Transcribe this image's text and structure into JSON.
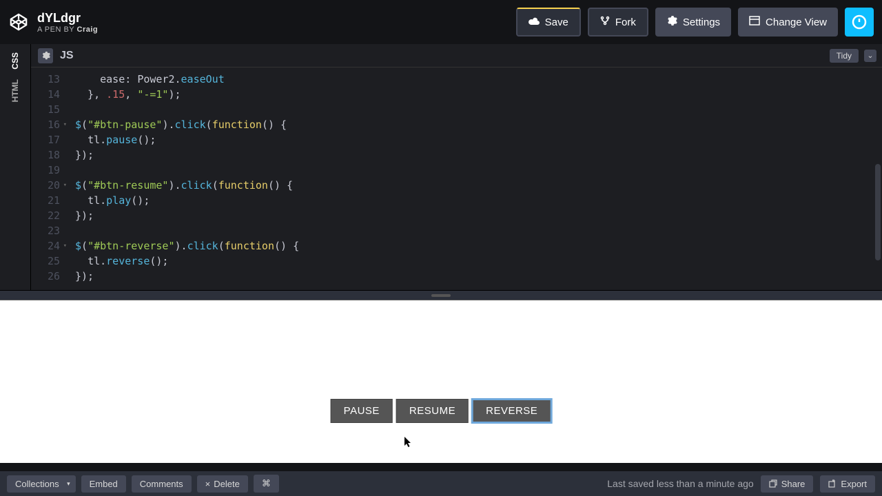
{
  "header": {
    "title": "dYLdgr",
    "byline_prefix": "A PEN BY ",
    "author": "Craig",
    "save": "Save",
    "fork": "Fork",
    "settings": "Settings",
    "change_view": "Change View"
  },
  "tabs": {
    "css": "CSS",
    "html": "HTML"
  },
  "editor": {
    "label": "JS",
    "tidy": "Tidy",
    "lines": [
      {
        "n": "13",
        "t": "    ease: Power2.easeOut"
      },
      {
        "n": "14",
        "t": "  }, .15, \"-=1\");"
      },
      {
        "n": "15",
        "t": ""
      },
      {
        "n": "16",
        "t": "$(\"#btn-pause\").click(function() {",
        "fold": true
      },
      {
        "n": "17",
        "t": "  tl.pause();"
      },
      {
        "n": "18",
        "t": "});"
      },
      {
        "n": "19",
        "t": ""
      },
      {
        "n": "20",
        "t": "$(\"#btn-resume\").click(function() {",
        "fold": true
      },
      {
        "n": "21",
        "t": "  tl.play();"
      },
      {
        "n": "22",
        "t": "});"
      },
      {
        "n": "23",
        "t": ""
      },
      {
        "n": "24",
        "t": "$(\"#btn-reverse\").click(function() {",
        "fold": true
      },
      {
        "n": "25",
        "t": "  tl.reverse();"
      },
      {
        "n": "26",
        "t": "});"
      }
    ]
  },
  "preview": {
    "buttons": {
      "pause": "PAUSE",
      "resume": "RESUME",
      "reverse": "REVERSE"
    }
  },
  "footer": {
    "collections": "Collections",
    "embed": "Embed",
    "comments": "Comments",
    "delete": "Delete",
    "shortcut": "⌘",
    "status": "Last saved less than a minute ago",
    "share": "Share",
    "export": "Export"
  }
}
